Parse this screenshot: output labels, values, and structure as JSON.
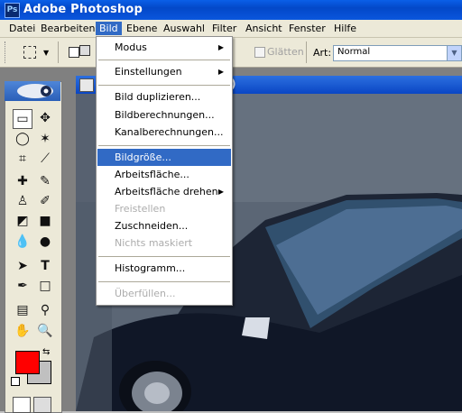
{
  "app": {
    "title": "Adobe Photoshop",
    "icon_text": "Ps"
  },
  "menubar": {
    "items": [
      "Datei",
      "Bearbeiten",
      "Bild",
      "Ebene",
      "Auswahl",
      "Filter",
      "Ansicht",
      "Fenster",
      "Hilfe"
    ],
    "active": "Bild"
  },
  "options": {
    "antialias_label": "Glätten",
    "art_label": "Art:",
    "art_value": "Normal"
  },
  "document": {
    "title_fragment": ")"
  },
  "dropdown": {
    "items": [
      {
        "label": "Modus",
        "submenu": true,
        "enabled": true
      },
      {
        "label": "Einstellungen",
        "submenu": true,
        "enabled": true
      },
      {
        "label": "Bild duplizieren...",
        "enabled": true
      },
      {
        "label": "Bildberechnungen...",
        "enabled": true
      },
      {
        "label": "Kanalberechnungen...",
        "enabled": true
      },
      {
        "label": "Bildgröße...",
        "enabled": true,
        "highlighted": true
      },
      {
        "label": "Arbeitsfläche...",
        "enabled": true
      },
      {
        "label": "Arbeitsfläche drehen",
        "submenu": true,
        "enabled": true
      },
      {
        "label": "Freistellen",
        "enabled": false
      },
      {
        "label": "Zuschneiden...",
        "enabled": true
      },
      {
        "label": "Nichts maskiert",
        "enabled": false
      },
      {
        "label": "Histogramm...",
        "enabled": true
      },
      {
        "label": "Überfüllen...",
        "enabled": false
      }
    ]
  },
  "colors": {
    "foreground": "#ff0000",
    "background": "#c0c0c0",
    "highlight": "#316ac5"
  },
  "tools": [
    "rect-marquee-tool",
    "move-tool",
    "lasso-tool",
    "magic-wand-tool",
    "crop-tool",
    "slice-tool",
    "healing-brush-tool",
    "brush-tool",
    "clone-stamp-tool",
    "history-brush-tool",
    "eraser-tool",
    "gradient-tool",
    "blur-tool",
    "dodge-tool",
    "path-selection-tool",
    "type-tool",
    "pen-tool",
    "shape-tool",
    "notes-tool",
    "eyedropper-tool",
    "hand-tool",
    "zoom-tool"
  ]
}
